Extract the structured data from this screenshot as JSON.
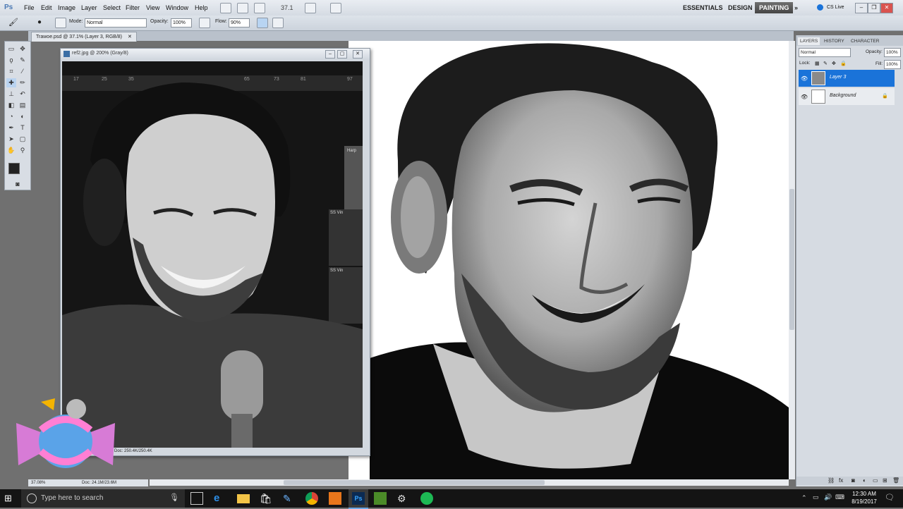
{
  "app": {
    "logo": "Ps"
  },
  "menu": [
    "File",
    "Edit",
    "Image",
    "Layer",
    "Select",
    "Filter",
    "View",
    "Window",
    "Help"
  ],
  "zoom_field": "37.1",
  "workspaces": {
    "essentials": "ESSENTIALS",
    "design": "DESIGN",
    "painting": "PAINTING",
    "more": "»"
  },
  "cslive": "CS Live",
  "options": {
    "mode_label": "Mode:",
    "mode_value": "Normal",
    "opacity_label": "Opacity:",
    "opacity_value": "100%",
    "flow_label": "Flow:",
    "flow_value": "90%"
  },
  "doc_tab": "Trawoe.psd @ 37.1% (Layer 3, RGB/8)",
  "ref_window": {
    "title": "ref2.jpg @ 200% (Gray/8)",
    "timeline_ticks": [
      "17",
      "25",
      "35",
      "65",
      "73",
      "81",
      "97"
    ],
    "plugin_label": "Harp",
    "vst_labels": [
      "SS Vin",
      "SS Vin"
    ],
    "status_doc": "Doc: 250.4K/250.4K"
  },
  "status": {
    "zoom": "37.08%",
    "doc": "Doc: 24.1M/23.6M"
  },
  "panels": {
    "tabs": [
      "LAYERS",
      "HISTORY",
      "CHARACTER"
    ],
    "blend_mode": "Normal",
    "opacity_label": "Opacity:",
    "opacity_value": "100%",
    "lock_label": "Lock:",
    "fill_label": "Fill:",
    "fill_value": "100%",
    "layers": [
      {
        "name": "Layer 3",
        "selected": true
      },
      {
        "name": "Background",
        "selected": false
      }
    ]
  },
  "taskbar": {
    "search_placeholder": "Type here to search",
    "time": "12:30 AM",
    "date": "8/19/2017"
  },
  "colors": {
    "accent": "#1a73d9",
    "taskbar": "#141414",
    "ps_active_ws": "#555555"
  }
}
